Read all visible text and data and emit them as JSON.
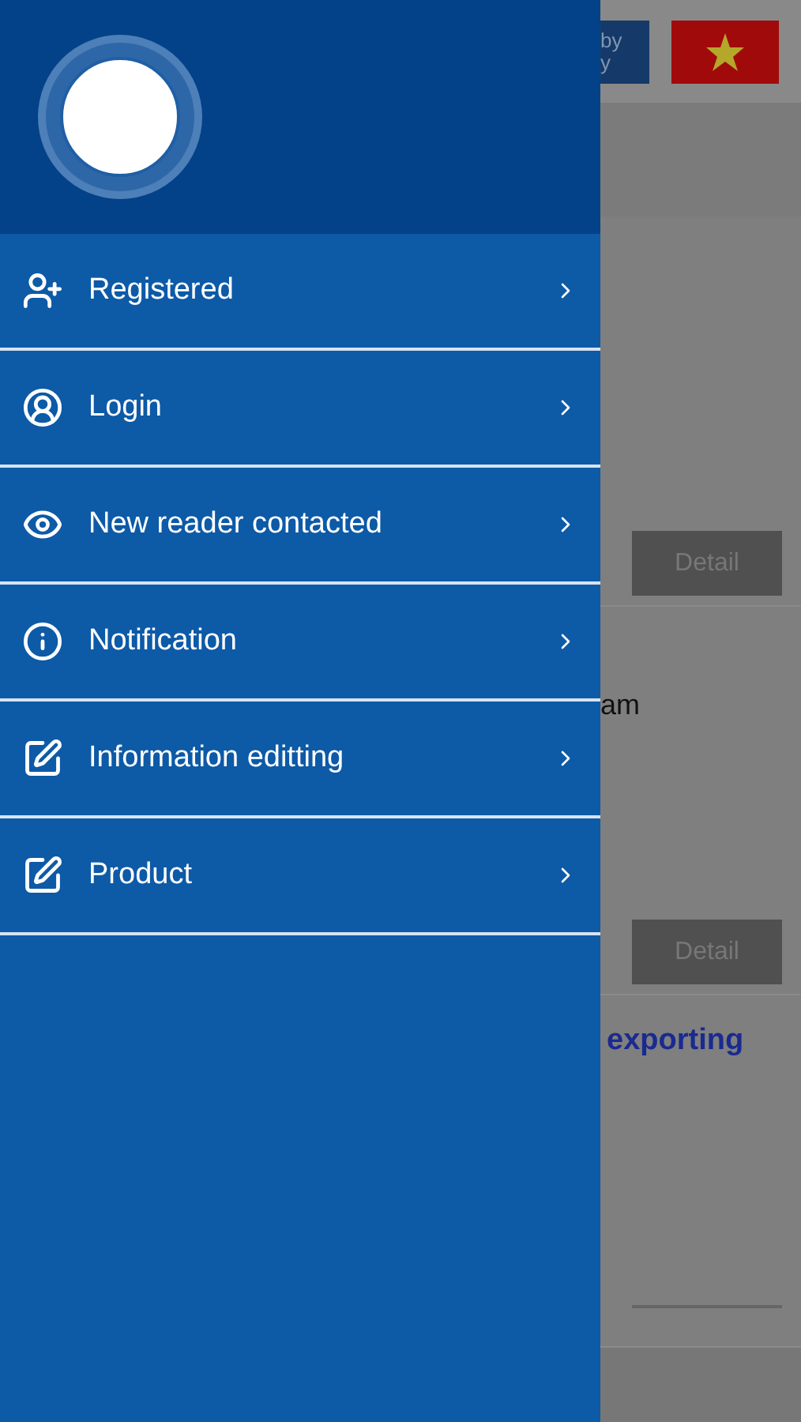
{
  "drawer": {
    "menu": [
      {
        "label": "Registered",
        "kind": "register"
      },
      {
        "label": "Login",
        "kind": "login"
      },
      {
        "label": "New reader contacted",
        "kind": "reader"
      },
      {
        "label": "Notification",
        "kind": "notice"
      },
      {
        "label": "Information editting",
        "kind": "edit"
      },
      {
        "label": "Product",
        "kind": "edit"
      }
    ]
  },
  "background": {
    "top_button": [
      "by",
      "y"
    ],
    "cards": [
      {
        "button": "Detail"
      },
      {
        "text": "am",
        "button": "Detail"
      },
      {
        "title": "exporting"
      }
    ]
  }
}
